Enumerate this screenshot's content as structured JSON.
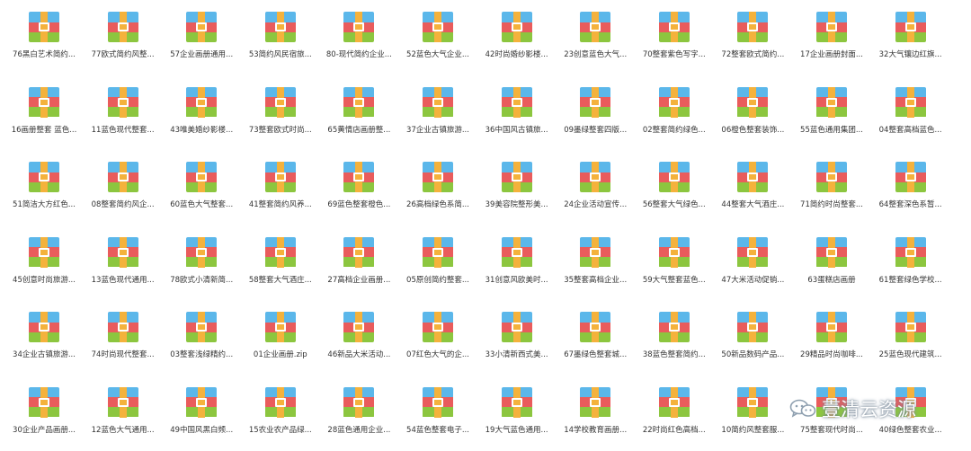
{
  "colors": {
    "top": "#5bb7ea",
    "middle": "#e95c5c",
    "bottom": "#8cc63f",
    "strap": "#f4b23c"
  },
  "icon": "archive-zip-icon",
  "watermark": {
    "text": "壹清云资源",
    "icon": "wechat-icon"
  },
  "files": [
    [
      "76黑白艺术简约...",
      "77欧式简约风整...",
      "57企业画册通用...",
      "53简约风民宿旅...",
      "80-现代简约企业...",
      "52蓝色大气企业...",
      "42时尚婚纱影楼...",
      "23创意蓝色大气...",
      "70整套紫色写字...",
      "72整套欧式简约...",
      "17企业画册封面...",
      "32大气镶边红旗..."
    ],
    [
      "16画册整套 蓝色...",
      "11蓝色现代整套...",
      "43唯美婚纱影楼...",
      "73整套欧式时尚...",
      "65黄情店画册整...",
      "37企业古镇旅游...",
      "36中国风古镇旅...",
      "09墨绿整套四版...",
      "02整套简约绿色...",
      "06橙色整套装饰...",
      "55蓝色通用集团...",
      "04整套高档蓝色..."
    ],
    [
      "51简洁大方红色...",
      "08整套简约风企...",
      "60蓝色大气整套...",
      "41整套简约风养...",
      "69蓝色整套橙色...",
      "26高档绿色系简...",
      "39美容院整形美...",
      "24企业活动宣传...",
      "56整套大气绿色...",
      "44整套大气酒庄...",
      "71简约时尚整套...",
      "64整套深色系暂..."
    ],
    [
      "45创意时尚旅游...",
      "13蓝色现代通用...",
      "78欧式小清新简...",
      "58整套大气酒庄...",
      "27高档企业画册...",
      "05原创简约整套...",
      "31创意风欧美时...",
      "35整套高档企业...",
      "59大气整套蓝色...",
      "47大米活动促销...",
      "63蛋糕店画册",
      "61整套绿色学校..."
    ],
    [
      "34企业古镇旅游...",
      "74时尚现代整套...",
      "03整套浅绿精约...",
      "01企业画册.zip",
      "46新品大米活动...",
      "07红色大气的企...",
      "33小清新西式美...",
      "67墨绿色整套城...",
      "38蓝色整套简约...",
      "50新品数码产品...",
      "29精品时尚咖啡...",
      "25蓝色现代建筑..."
    ],
    [
      "30企业产品画册...",
      "12蓝色大气通用...",
      "49中国风黑白频...",
      "15农业农产品绿...",
      "28蓝色通用企业...",
      "54蓝色整套电子...",
      "19大气蓝色通用...",
      "14学校教育画册...",
      "22时尚红色高档...",
      "10简约风整套服...",
      "75整套现代时尚...",
      "40绿色整套农业..."
    ]
  ]
}
